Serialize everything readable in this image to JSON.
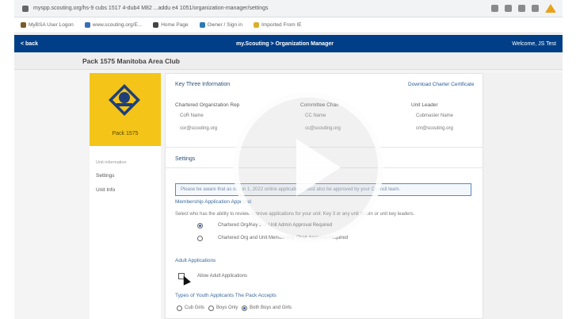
{
  "browser": {
    "url": "myspp.scouting.org/hs-9 cubs 1517 4-dub4 M82 ...addu e4 1051/organization-manager/settings",
    "bookmarks": [
      {
        "label": "MyBSA User Logon",
        "color": "#7a5a2a"
      },
      {
        "label": "www.scouting.org/E...",
        "color": "#3b6db5"
      },
      {
        "label": "Home Page",
        "color": "#444444"
      },
      {
        "label": "Owner / Sign in",
        "color": "#2a7ab8"
      },
      {
        "label": "Imported From IE",
        "color": "#d8b030"
      }
    ]
  },
  "navbar": {
    "back_label": "< back",
    "center_label": "my.Scouting > Organization Manager",
    "user_label": "Welcome, JS Test"
  },
  "unit": {
    "title": "Pack 1575 Manitoba Area Club",
    "pack_label": "Pack 1575"
  },
  "sidebar": {
    "section_label": "Unit information",
    "items": [
      "Settings",
      "Unit Info"
    ]
  },
  "team_info": {
    "heading": "Key Three Information",
    "certificate_link": "Download Charter Certificate",
    "columns": [
      "Chartered Organization Rep",
      "Committee Chair",
      "Unit Leader"
    ],
    "rows": [
      [
        "CoR Name",
        "CC Name",
        "Cubmaster Name"
      ],
      [
        "cor@scouting.org",
        "cc@scouting.org",
        "cm@scouting.org"
      ]
    ]
  },
  "settings": {
    "heading": "Settings",
    "notice": "Please be aware that as of Jun 1, 2022 online applications must also be approved by your Council team.",
    "membership_label": "Membership Application Approval",
    "membership_desc": "Select who has the ability to review/approve applications for your unit: Key 3 or any unit admin or unit key leaders.",
    "approval_options": [
      {
        "label": "Chartered Org/Key 3 or Unit Admin Approval Required",
        "selected": true
      },
      {
        "label": "Chartered Org and Unit Membership Chair Approval Required",
        "selected": false
      }
    ],
    "adult_label": "Adult Applications",
    "adult_option": "Allow Adult Applications",
    "youth_label": "Types of Youth Applicants The Pack Accepts",
    "youth_options": [
      {
        "label": "Cub Girls",
        "selected": false
      },
      {
        "label": "Boys Only",
        "selected": false
      },
      {
        "label": "Both Boys and Girls",
        "selected": true
      }
    ]
  },
  "colors": {
    "navbar": "#003f87",
    "emblem": "#f4c418",
    "link": "#2a5d9a"
  }
}
